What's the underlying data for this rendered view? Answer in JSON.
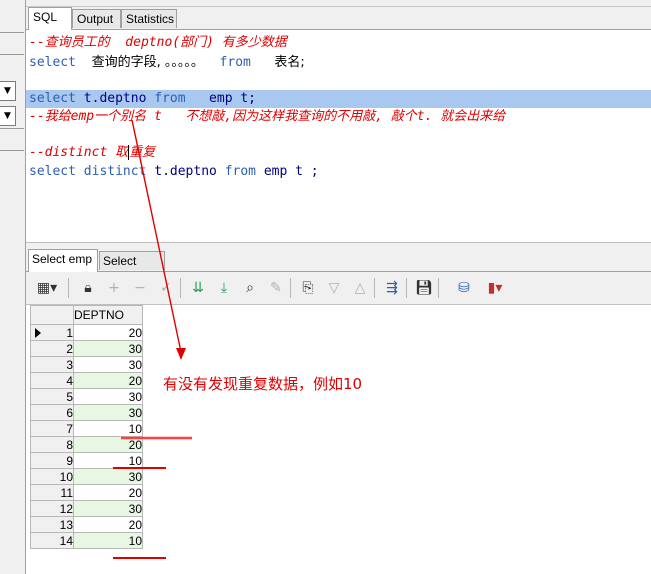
{
  "tabs": [
    "SQL",
    "Output",
    "Statistics"
  ],
  "editor": {
    "line1": {
      "comment": "--查询员工的  deptno(部门) 有多少数据"
    },
    "line2": {
      "kw1": "select",
      "cn": "查询的字段, 。。。。。",
      "kw2": "from",
      "cn2": "表名;"
    },
    "line4": {
      "kw1": "select",
      "id1": "t.deptno",
      "kw2": "from",
      "id2": "emp t;"
    },
    "line5": {
      "comment": "--我给emp一个别名 t   不想敲,因为这样我查询的不用敲, 敲个t. 就会出来给"
    },
    "line7": {
      "comment_a": "--distinct 取",
      "comment_b": "重复"
    },
    "line8": {
      "kw1": "select",
      "kw2": "distinct",
      "id1": "t.deptno",
      "kw3": "from",
      "id2": "emp t ;"
    }
  },
  "result_tabs": [
    "Select emp",
    "Select emp"
  ],
  "toolbar_icons": [
    "grid-view-icon",
    "lock-icon",
    "add-row-icon",
    "delete-row-icon",
    "post-icon",
    "fetch-next-icon",
    "fetch-all-icon",
    "find-icon",
    "clear-icon",
    "query-by-example-icon",
    "filter-down-icon",
    "filter-up-icon",
    "export-icon",
    "save-icon",
    "database-icon",
    "chart-icon"
  ],
  "grid": {
    "column": "DEPTNO",
    "rows": [
      {
        "n": "1",
        "v": "20"
      },
      {
        "n": "2",
        "v": "30"
      },
      {
        "n": "3",
        "v": "30"
      },
      {
        "n": "4",
        "v": "20"
      },
      {
        "n": "5",
        "v": "30"
      },
      {
        "n": "6",
        "v": "30"
      },
      {
        "n": "7",
        "v": "10"
      },
      {
        "n": "8",
        "v": "20"
      },
      {
        "n": "9",
        "v": "10"
      },
      {
        "n": "10",
        "v": "30"
      },
      {
        "n": "11",
        "v": "20"
      },
      {
        "n": "12",
        "v": "30"
      },
      {
        "n": "13",
        "v": "20"
      },
      {
        "n": "14",
        "v": "10"
      }
    ]
  },
  "annotation": {
    "text": "有没有发现重复数据，例如10",
    "color": "#e00000"
  }
}
